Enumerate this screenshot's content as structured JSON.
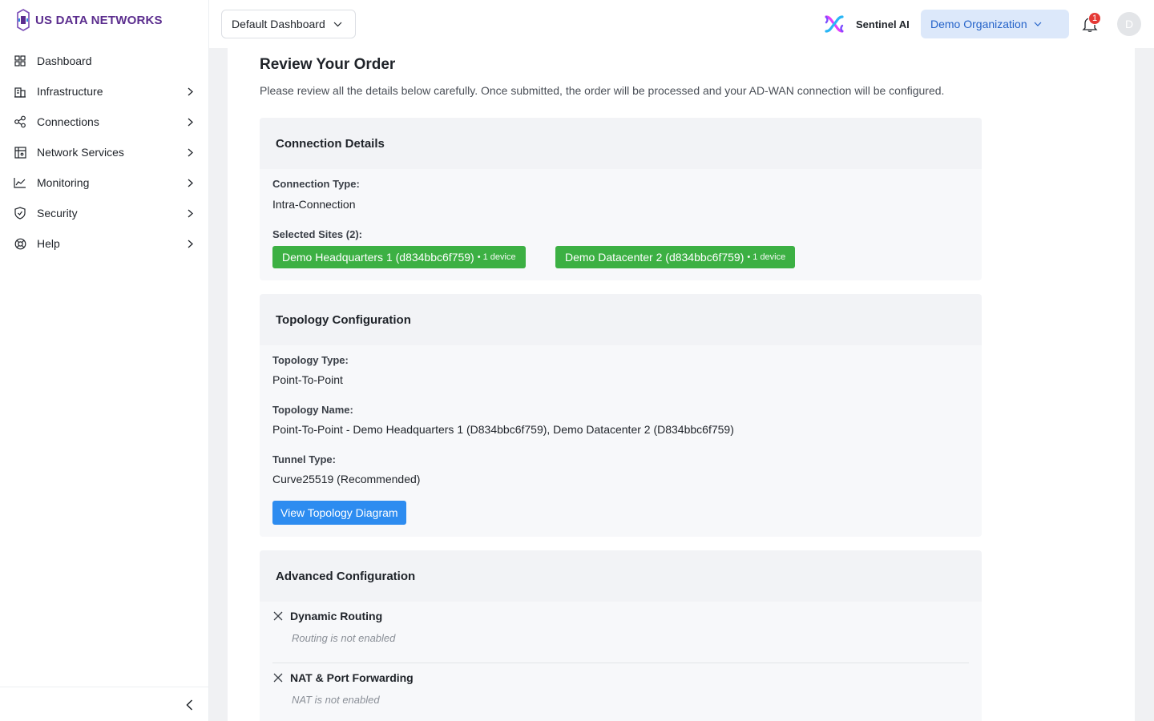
{
  "brand": {
    "name": "US DATA NETWORKS",
    "color": "#5b2d8e"
  },
  "sidebar": {
    "items": [
      {
        "label": "Dashboard",
        "icon": "grid-icon",
        "has_children": false
      },
      {
        "label": "Infrastructure",
        "icon": "building-icon",
        "has_children": true
      },
      {
        "label": "Connections",
        "icon": "share-nodes-icon",
        "has_children": true
      },
      {
        "label": "Network Services",
        "icon": "network-grid-icon",
        "has_children": true
      },
      {
        "label": "Monitoring",
        "icon": "line-chart-icon",
        "has_children": true
      },
      {
        "label": "Security",
        "icon": "shield-icon",
        "has_children": true
      },
      {
        "label": "Help",
        "icon": "lifebuoy-icon",
        "has_children": true
      }
    ]
  },
  "topbar": {
    "dashboard_select": "Default Dashboard",
    "sentinel_label": "Sentinel AI",
    "organization": "Demo Organization",
    "notification_count": "1",
    "avatar_initial": "D"
  },
  "page": {
    "title": "Review Your Order",
    "description": "Please review all the details below carefully. Once submitted, the order will be processed and your AD-WAN connection will be configured."
  },
  "connection_details": {
    "heading": "Connection Details",
    "type_label": "Connection Type:",
    "type_value": "Intra-Connection",
    "sites_label": "Selected Sites (2):",
    "sites": [
      {
        "name": "Demo Headquarters 1 (d834bbc6f759)",
        "meta": "• 1 device"
      },
      {
        "name": "Demo Datacenter 2 (d834bbc6f759)",
        "meta": "• 1 device"
      }
    ]
  },
  "topology": {
    "heading": "Topology Configuration",
    "type_label": "Topology Type:",
    "type_value": "Point-To-Point",
    "name_label": "Topology Name:",
    "name_value": "Point-To-Point - Demo Headquarters 1 (D834bbc6f759), Demo Datacenter 2 (D834bbc6f759)",
    "tunnel_label": "Tunnel Type:",
    "tunnel_value": "Curve25519 (Recommended)",
    "diagram_button": "View Topology Diagram"
  },
  "advanced": {
    "heading": "Advanced Configuration",
    "items": [
      {
        "title": "Dynamic Routing",
        "status": "Routing is not enabled"
      },
      {
        "title": "NAT & Port Forwarding",
        "status": "NAT is not enabled"
      }
    ]
  },
  "colors": {
    "accent_blue": "#2d8cf0",
    "site_green": "#3cb043",
    "org_bg": "#dce8fa",
    "badge_red": "#e53935"
  }
}
